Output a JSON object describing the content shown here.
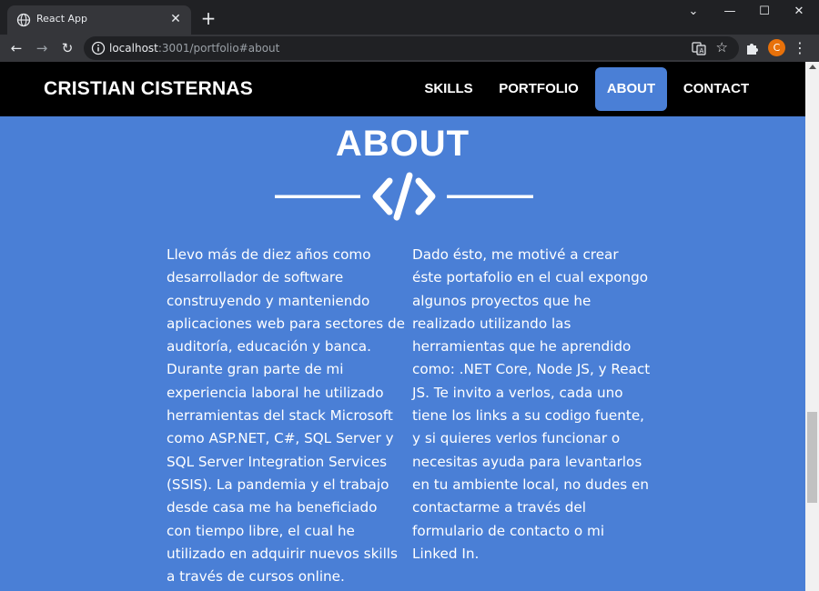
{
  "browser": {
    "tab_title": "React App",
    "tab_close_glyph": "✕",
    "new_tab_glyph": "+",
    "url_host": "localhost",
    "url_rest": ":3001/portfolio#about",
    "profile_initial": "C",
    "controls": {
      "chevron_glyph": "⌄",
      "minimize_glyph": "—",
      "maximize_glyph": "☐",
      "close_glyph": "✕",
      "back_glyph": "←",
      "forward_glyph": "→",
      "reload_glyph": "↻",
      "star_glyph": "☆",
      "menu_glyph": "⋮"
    },
    "icons": [
      "globe-icon",
      "close-icon",
      "plus-icon",
      "chevron-down-icon",
      "minimize-icon",
      "maximize-icon",
      "back-icon",
      "forward-icon",
      "reload-icon",
      "info-icon",
      "translate-icon",
      "star-icon",
      "puzzle-icon",
      "kebab-menu-icon"
    ]
  },
  "site": {
    "brand": "CRISTIAN CISTERNAS",
    "nav": [
      {
        "label": "SKILLS",
        "active": false
      },
      {
        "label": "PORTFOLIO",
        "active": false
      },
      {
        "label": "ABOUT",
        "active": true
      },
      {
        "label": "CONTACT",
        "active": false
      }
    ],
    "section_title": "ABOUT",
    "divider_icon": "code-icon",
    "left_paragraph": "Llevo más de diez años como desarrollador de software construyendo y manteniendo aplicaciones web para sectores de auditoría, educación y banca. Durante gran parte de mi experiencia laboral he utilizado herramientas del stack Microsoft como ASP.NET, C#, SQL Server y SQL Server Integration Services (SSIS). La pandemia y el trabajo desde casa me ha beneficiado con tiempo libre, el cual he utilizado en adquirir nuevos skills a través de cursos online.",
    "right_paragraph": "Dado ésto, me motivé a crear éste portafolio en el cual expongo algunos proyectos que he realizado utilizando las herramientas que he aprendido como: .NET Core, Node JS, y React JS. Te invito a verlos, cada uno tiene los links a su codigo fuente, y si quieres verlos funcionar o necesitas ayuda para levantarlos en tu ambiente local, no dudes en contactarme a través del formulario de contacto o mi Linked In."
  },
  "colors": {
    "accent": "#4a7fd6",
    "nav_bg": "#000000",
    "chrome_bg": "#202124",
    "toolbar_bg": "#35363a",
    "avatar": "#e8710a"
  }
}
